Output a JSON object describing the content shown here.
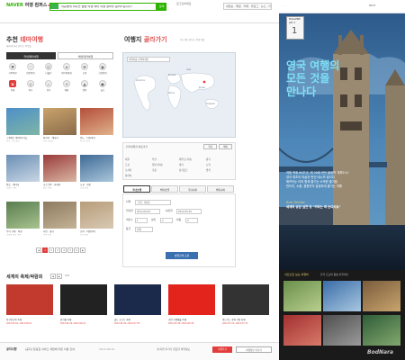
{
  "header": {
    "logo_brand": "NAVER",
    "logo_service": "여행 컴퍼스",
    "logo_badge": "Beta",
    "search_text": "여유롭게 떠나는 캠핑 여행 테마 여행 정보를 알려드립니다!",
    "search_button": "검색",
    "login_text": "로그인하세요",
    "gnb_links": "내정보 · 메일 · 카페 · 블로그 · 뉴스 · 다음"
  },
  "theme": {
    "title_plain": "추천 ",
    "title_accent": "테마여행",
    "subtitle": "테마에 따라 원하는 여행을",
    "tabs": [
      "국내테마여행",
      "해외테마여행"
    ],
    "icons": [
      {
        "label": "가족여행",
        "glyph": "♥"
      },
      {
        "label": "연인여행",
        "glyph": "♡"
      },
      {
        "label": "나홀로",
        "glyph": "☺"
      },
      {
        "label": "아이와함께",
        "glyph": "★"
      },
      {
        "label": "쇼핑",
        "glyph": "✚"
      },
      {
        "label": "산림여행",
        "glyph": "▣"
      },
      {
        "label": "축제",
        "glyph": "✿"
      },
      {
        "label": "바다",
        "glyph": "◎"
      },
      {
        "label": "음식",
        "glyph": "♨"
      },
      {
        "label": "체험",
        "glyph": "✦"
      },
      {
        "label": "캠핑",
        "glyph": "▲"
      },
      {
        "label": "골프",
        "glyph": "●"
      }
    ],
    "items": [
      {
        "title": "그레이트 배리어 리프",
        "sub": "호주 · 퀸즈랜드"
      },
      {
        "title": "캘거리 · 캐나다",
        "sub": "로키 마운틴"
      },
      {
        "title": "인도 · 타지마할",
        "sub": "아그라 여행"
      },
      {
        "title": "밴프 · 캐나다",
        "sub": "호숫가 여행"
      },
      {
        "title": "모스크바 · 러시아",
        "sub": "붉은 광장"
      },
      {
        "title": "도쿄 · 일본",
        "sub": "도심 관광"
      },
      {
        "title": "우리 국내 · 서울",
        "sub": "도심의 여름 여행"
      },
      {
        "title": "시안 · 중국",
        "sub": "역사 기행"
      },
      {
        "title": "로마 · 이탈리아",
        "sub": "유적 탐방"
      }
    ],
    "pages": [
      "1",
      "2",
      "3",
      "4",
      "5",
      "6"
    ],
    "page_prev": "◀",
    "page_next": "▶"
  },
  "travel": {
    "title_plain": "여행지 ",
    "title_accent": "골라가기",
    "subtitle": "지도에서 원하는 여행지를",
    "map_select": "여행지를 선택하세요",
    "map_labels": [
      "Europe",
      "Asia",
      "Africa",
      "Oceania",
      "America",
      "Korea"
    ],
    "picker_label": "인기여행지 바로가기",
    "picker_btns": [
      "국내",
      "해외"
    ],
    "cities": [
      "서울",
      "부산",
      "제주도(국내)",
      "중국",
      "도쿄",
      "일본(국내)",
      "파리",
      "뉴욕",
      "오사카",
      "홍콩",
      "싱가포르",
      "방콕",
      "상하이"
    ],
    "tabs": [
      "국내호텔",
      "해외호텔",
      "국내숙박",
      "해외숙박"
    ],
    "form": [
      {
        "label": "지역",
        "value": "그랜드 하얏트"
      },
      {
        "label": "입실일",
        "value": "2012.06.29"
      },
      {
        "label": "퇴실일",
        "value": "2012.06.30"
      },
      {
        "label": "객실수",
        "value": "1"
      },
      {
        "label": "성인",
        "value": "2"
      },
      {
        "label": "아동",
        "value": "0"
      },
      {
        "label": "등급",
        "value": "전체"
      }
    ],
    "search_button": "호텔검색 조회"
  },
  "magazine": {
    "label_top": "MAGAZINE",
    "label_issue": "JULY 1",
    "label_num": "1",
    "links": [
      "이전호보기",
      "NEXT"
    ],
    "headline_lines": [
      "영국 여행의",
      "모든 것을",
      "만나다"
    ],
    "articles": [
      "여왕 즉위 60주년, 제 30회 런던 올림픽 개최도시!",
      "영국 최초의 마술관 런던 데시보 열리다",
      "애프터눈 티와 함께 즐기는 소박한 즐거움",
      "빈티지, 소품, 음원까지 꼼꼼하게 즐기는 여행"
    ],
    "section_title": "Best Review",
    "section_text": "세계의 공감 실천 및 \"카라는 떠 손다리요\"",
    "bottom_title": "서인으로 보는 여행비",
    "bottom_sub": "한국 근교의 동호 여행이란",
    "watermark": "BodNara"
  },
  "festivals": {
    "title": "세계의 축제/박람회",
    "page_indicator": "1/3",
    "items": [
      {
        "title": "탕구탄고아 축제",
        "date": "2012.05.01~2012.06.01"
      },
      {
        "title": "뮤지컬 축제",
        "date": "2012.06.16~2012.06.21"
      },
      {
        "title": "골드 코스트 축제",
        "date": "2012.06.30~2012.07.30"
      },
      {
        "title": "공연 국제예술 축제",
        "date": "2012.05.30~2012.06.30"
      },
      {
        "title": "마드리드 국제 극장 축제",
        "date": "2012.07.01~2012.07.31"
      }
    ],
    "tag": "Now"
  },
  "footer": {
    "label": "공지사항",
    "text": "[공지] 항공권 서비스 개편에 따른 이용 안내",
    "date": "2012.06.29",
    "link": "내 여행 후기가 필요한 여행정보",
    "btn1": "여행후기",
    "btn2": "여행정보 더보기"
  }
}
